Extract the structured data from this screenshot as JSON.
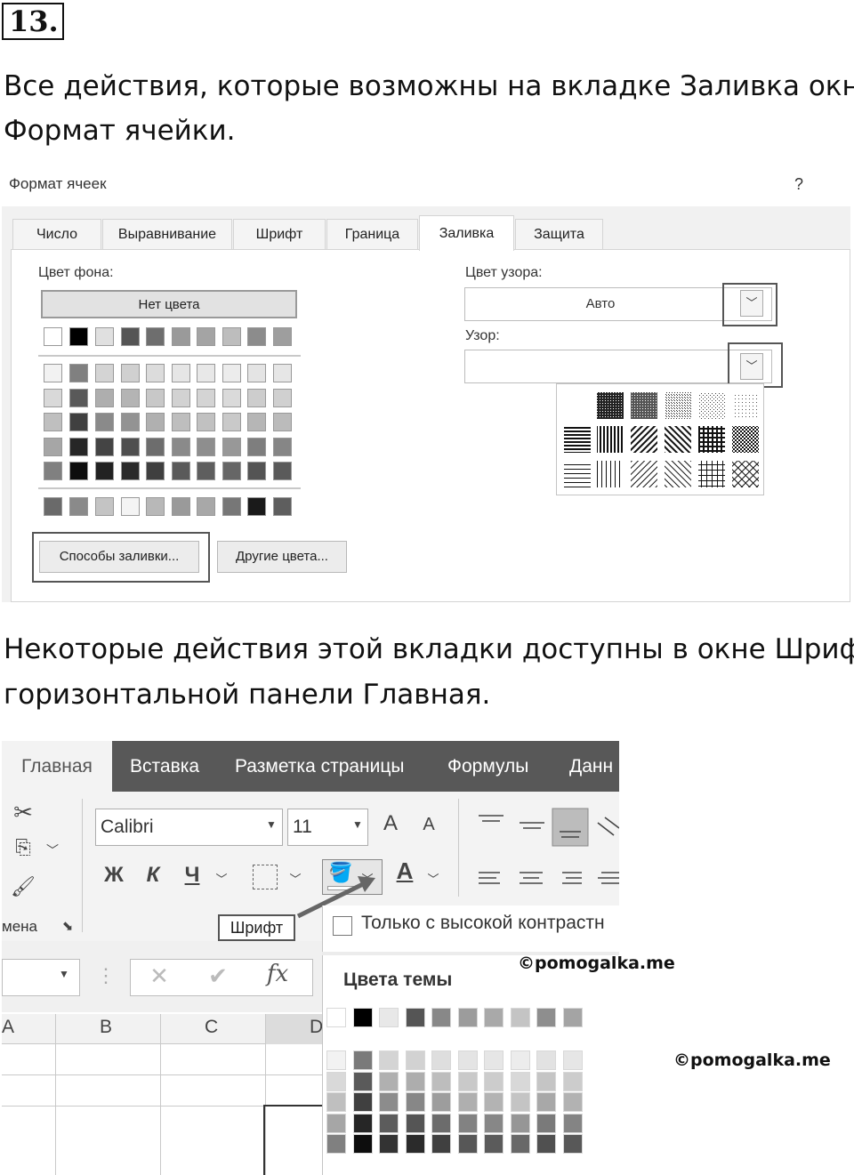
{
  "task": {
    "number": "13.",
    "para1_line1": "Все действия, которые возможны на вкладке Заливка окна",
    "para1_line2": "Формат ячейки.",
    "para2_line1": "Некоторые действия этой вкладки доступны в окне Шрифт",
    "para2_line2": "горизонтальной панели Главная."
  },
  "dialog": {
    "title": "Формат ячеек",
    "help": "?",
    "tabs": [
      "Число",
      "Выравнивание",
      "Шрифт",
      "Граница",
      "Заливка",
      "Защита"
    ],
    "active_tab": "Заливка",
    "bg_label": "Цвет фона:",
    "no_color": "Нет цвета",
    "fill_effects": "Способы заливки...",
    "more_colors": "Другие цвета...",
    "pattern_color_label": "Цвет узора:",
    "pattern_color_value": "Авто",
    "pattern_style_label": "Узор:",
    "chevron": "﹀"
  },
  "ribbon": {
    "tabs": [
      "Главная",
      "Вставка",
      "Разметка страницы",
      "Формулы",
      "Данн"
    ],
    "font_name": "Calibri",
    "font_size": "11",
    "bold": "Ж",
    "italic": "К",
    "underline": "Ч",
    "grow": "A",
    "shrink": "A",
    "font_color": "A",
    "clipboard_label": "мена",
    "group_label": "Шрифт",
    "fx": "fx",
    "cancel": "✕",
    "enter": "✔",
    "col_a": "A",
    "col_b": "B",
    "col_c": "C",
    "col_d": "D"
  },
  "dropdown": {
    "checkbox_label": "Только с высокой контрастн",
    "theme_colors": "Цвета темы"
  },
  "watermark1": "©pomogalka.me",
  "watermark2": "©pomogalka.me",
  "colors": {
    "ribbon_bar": "#585858",
    "ribbon_body": "#f3f3f3"
  }
}
